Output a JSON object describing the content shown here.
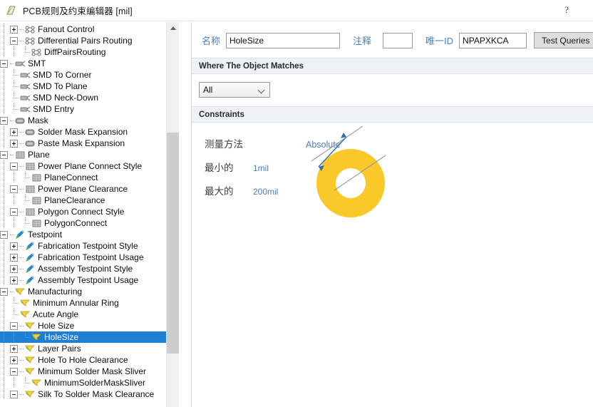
{
  "window": {
    "title": "PCB规则及约束编辑器 [mil]",
    "help_label": "?",
    "app_icon": "pcb-rules-icon"
  },
  "tree": {
    "items": [
      {
        "label": "Fanout Control",
        "depth": 1,
        "icon": "routing-icon",
        "expander": "plus",
        "selected": false
      },
      {
        "label": "Differential Pairs Routing",
        "depth": 1,
        "icon": "routing-icon",
        "expander": "minus",
        "selected": false
      },
      {
        "label": "DiffPairsRouting",
        "depth": 2,
        "icon": "routing-icon",
        "expander": "none",
        "selected": false
      },
      {
        "label": "SMT",
        "depth": 0,
        "icon": "smt-icon",
        "expander": "minus",
        "selected": false
      },
      {
        "label": "SMD To Corner",
        "depth": 1,
        "icon": "smt-icon",
        "expander": "none",
        "selected": false
      },
      {
        "label": "SMD To Plane",
        "depth": 1,
        "icon": "smt-icon",
        "expander": "none",
        "selected": false
      },
      {
        "label": "SMD Neck-Down",
        "depth": 1,
        "icon": "smt-icon",
        "expander": "none",
        "selected": false
      },
      {
        "label": "SMD Entry",
        "depth": 1,
        "icon": "smt-icon",
        "expander": "none",
        "selected": false
      },
      {
        "label": "Mask",
        "depth": 0,
        "icon": "mask-icon",
        "expander": "minus",
        "selected": false
      },
      {
        "label": "Solder Mask Expansion",
        "depth": 1,
        "icon": "mask-icon",
        "expander": "plus",
        "selected": false
      },
      {
        "label": "Paste Mask Expansion",
        "depth": 1,
        "icon": "mask-icon",
        "expander": "plus",
        "selected": false
      },
      {
        "label": "Plane",
        "depth": 0,
        "icon": "plane-icon",
        "expander": "minus",
        "selected": false
      },
      {
        "label": "Power Plane Connect Style",
        "depth": 1,
        "icon": "plane-icon",
        "expander": "minus",
        "selected": false
      },
      {
        "label": "PlaneConnect",
        "depth": 2,
        "icon": "plane-icon",
        "expander": "none",
        "selected": false
      },
      {
        "label": "Power Plane Clearance",
        "depth": 1,
        "icon": "plane-icon",
        "expander": "minus",
        "selected": false
      },
      {
        "label": "PlaneClearance",
        "depth": 2,
        "icon": "plane-icon",
        "expander": "none",
        "selected": false
      },
      {
        "label": "Polygon Connect Style",
        "depth": 1,
        "icon": "plane-icon",
        "expander": "minus",
        "selected": false
      },
      {
        "label": "PolygonConnect",
        "depth": 2,
        "icon": "plane-icon",
        "expander": "none",
        "selected": false
      },
      {
        "label": "Testpoint",
        "depth": 0,
        "icon": "testpoint-icon",
        "expander": "minus",
        "selected": false
      },
      {
        "label": "Fabrication Testpoint Style",
        "depth": 1,
        "icon": "testpoint-icon",
        "expander": "plus",
        "selected": false
      },
      {
        "label": "Fabrication Testpoint Usage",
        "depth": 1,
        "icon": "testpoint-icon",
        "expander": "plus",
        "selected": false
      },
      {
        "label": "Assembly Testpoint Style",
        "depth": 1,
        "icon": "testpoint-icon",
        "expander": "plus",
        "selected": false
      },
      {
        "label": "Assembly Testpoint Usage",
        "depth": 1,
        "icon": "testpoint-icon",
        "expander": "plus",
        "selected": false
      },
      {
        "label": "Manufacturing",
        "depth": 0,
        "icon": "manufacturing-icon",
        "expander": "minus",
        "selected": false
      },
      {
        "label": "Minimum Annular Ring",
        "depth": 1,
        "icon": "manufacturing-icon",
        "expander": "none",
        "selected": false
      },
      {
        "label": "Acute Angle",
        "depth": 1,
        "icon": "manufacturing-icon",
        "expander": "none",
        "selected": false
      },
      {
        "label": "Hole Size",
        "depth": 1,
        "icon": "manufacturing-icon",
        "expander": "minus",
        "selected": false
      },
      {
        "label": "HoleSize",
        "depth": 2,
        "icon": "manufacturing-icon",
        "expander": "none",
        "selected": true
      },
      {
        "label": "Layer Pairs",
        "depth": 1,
        "icon": "manufacturing-icon",
        "expander": "plus",
        "selected": false
      },
      {
        "label": "Hole To Hole Clearance",
        "depth": 1,
        "icon": "manufacturing-icon",
        "expander": "plus",
        "selected": false
      },
      {
        "label": "Minimum Solder Mask Sliver",
        "depth": 1,
        "icon": "manufacturing-icon",
        "expander": "minus",
        "selected": false
      },
      {
        "label": "MinimumSolderMaskSliver",
        "depth": 2,
        "icon": "manufacturing-icon",
        "expander": "none",
        "selected": false
      },
      {
        "label": "Silk To Solder Mask Clearance",
        "depth": 1,
        "icon": "manufacturing-icon",
        "expander": "minus",
        "selected": false
      }
    ]
  },
  "form": {
    "name_label": "名称",
    "name_value": "HoleSize",
    "comment_label": "注释",
    "comment_value": "",
    "unique_id_label": "唯一ID",
    "unique_id_value": "NPAPXKCA",
    "test_queries_label": "Test Queries"
  },
  "where_section": {
    "header": "Where The Object Matches",
    "scope_value": "All"
  },
  "constraints": {
    "header": "Constraints",
    "measurement_label": "测量方法",
    "measurement_value": "Absolute",
    "minimum_label": "最小的",
    "minimum_value": "1mil",
    "maximum_label": "最大的",
    "maximum_value": "200mil"
  },
  "colors": {
    "selection_blue": "#1e7fd4",
    "link_blue": "#4a7fb5",
    "hole_yellow": "#fac828",
    "section_bar": "#eef1f5"
  }
}
